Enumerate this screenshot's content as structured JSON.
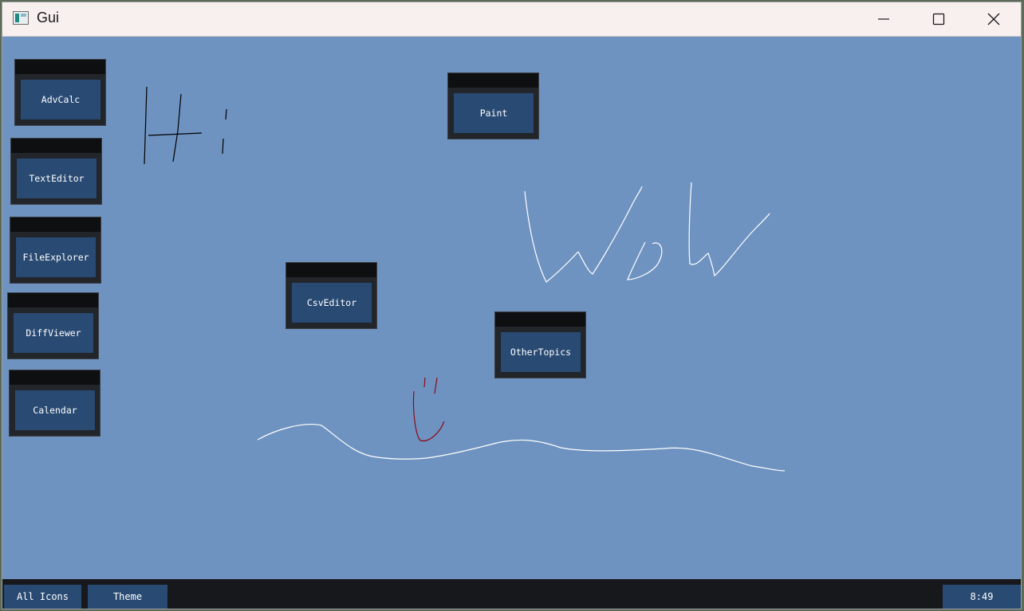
{
  "window": {
    "title": "Gui"
  },
  "titlebar_icons": {
    "app": "app-icon",
    "minimize": "minimize-icon",
    "maximize": "maximize-icon",
    "close": "close-icon"
  },
  "desktop": {
    "apps": [
      {
        "id": "advcalc",
        "label": "AdvCalc"
      },
      {
        "id": "texteditor",
        "label": "TextEditor"
      },
      {
        "id": "fileexplorer",
        "label": "FileExplorer"
      },
      {
        "id": "diffviewer",
        "label": "DiffViewer"
      },
      {
        "id": "calendar",
        "label": "Calendar"
      },
      {
        "id": "paint",
        "label": "Paint"
      },
      {
        "id": "csveditor",
        "label": "CsvEditor"
      },
      {
        "id": "othertopics",
        "label": "OtherTopics"
      }
    ]
  },
  "taskbar": {
    "all_icons_label": "All Icons",
    "theme_label": "Theme",
    "clock": "8:49"
  },
  "colors": {
    "desktop_bg": "#6f93c0",
    "app_button": "#294a73",
    "app_frame": "#222529",
    "taskbar": "#17181b",
    "titlebar": "#f8efef",
    "drawing_white": "#ffffff",
    "drawing_black": "#000000",
    "drawing_red": "#8b0a1a"
  }
}
